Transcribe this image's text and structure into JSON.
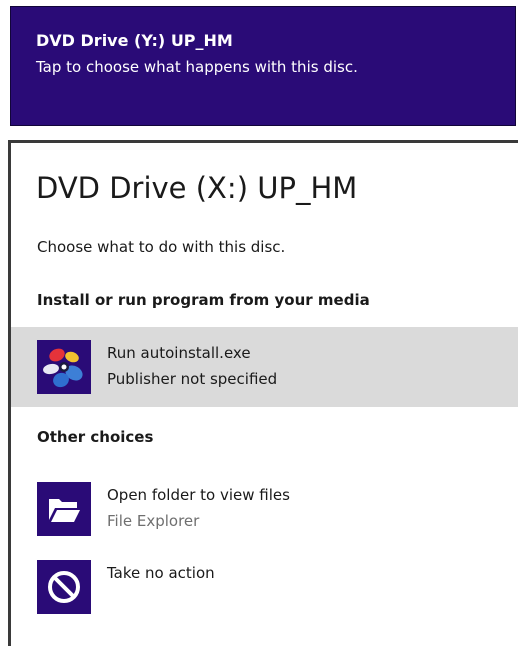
{
  "toast": {
    "title": "DVD Drive (Y:) UP_HM",
    "message": "Tap to choose what happens with this disc."
  },
  "dialog": {
    "title": "DVD Drive (X:) UP_HM",
    "subtitle": "Choose what to do with this disc."
  },
  "sections": {
    "install_heading": "Install or run program from your media",
    "other_heading": "Other choices"
  },
  "options": {
    "run": {
      "label": "Run autoinstall.exe",
      "sublabel": "Publisher not specified",
      "icon": "autoinstall-app-icon",
      "selected": true
    },
    "open_folder": {
      "label": "Open folder to view files",
      "sublabel": "File Explorer",
      "icon": "folder-open-icon"
    },
    "no_action": {
      "label": "Take no action",
      "icon": "no-action-icon"
    }
  },
  "colors": {
    "accent": "#2a0b77",
    "selected_background": "#dadada",
    "muted_text": "#6f6f6f"
  }
}
